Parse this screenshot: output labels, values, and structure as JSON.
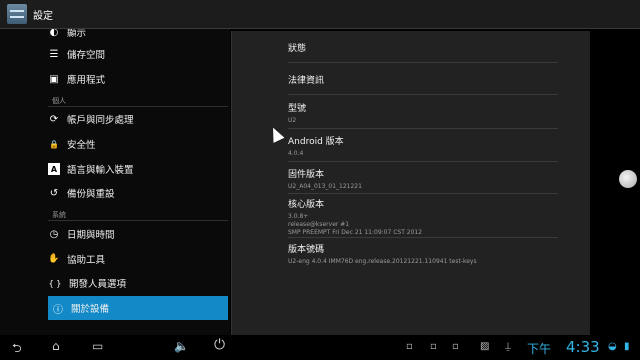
{
  "app": {
    "title": "設定"
  },
  "sidebar": {
    "items": [
      {
        "id": "display",
        "label": "顯示",
        "icon": "display-icon",
        "glyph": "◐"
      },
      {
        "id": "storage",
        "label": "儲存空間",
        "icon": "storage-icon",
        "glyph": "☰"
      },
      {
        "id": "apps",
        "label": "應用程式",
        "icon": "apps-icon",
        "glyph": "▣"
      },
      {
        "id": "accounts",
        "label": "帳戶與同步處理",
        "icon": "sync-icon",
        "glyph": "⟳"
      },
      {
        "id": "security",
        "label": "安全性",
        "icon": "lock-icon",
        "glyph": "🔒"
      },
      {
        "id": "language",
        "label": "語言與輸入裝置",
        "icon": "language-icon",
        "glyph": "A"
      },
      {
        "id": "backup",
        "label": "備份與重設",
        "icon": "backup-icon",
        "glyph": "↺"
      },
      {
        "id": "datetime",
        "label": "日期與時間",
        "icon": "clock-icon",
        "glyph": "◷"
      },
      {
        "id": "accessibility",
        "label": "協助工具",
        "icon": "hand-icon",
        "glyph": "✋"
      },
      {
        "id": "developer",
        "label": "開發人員選項",
        "icon": "developer-icon",
        "glyph": "{ }"
      },
      {
        "id": "about",
        "label": "關於設備",
        "icon": "info-icon",
        "glyph": "ⓘ"
      }
    ],
    "categories": {
      "personal": "個人",
      "system": "系統"
    }
  },
  "detail": {
    "rows": [
      {
        "title": "狀態",
        "sub": []
      },
      {
        "title": "法律資訊",
        "sub": []
      },
      {
        "title": "型號",
        "sub": [
          "U2"
        ]
      },
      {
        "title": "Android 版本",
        "sub": [
          "4.0.4"
        ]
      },
      {
        "title": "固件版本",
        "sub": [
          "U2_A04_013_01_121221"
        ]
      },
      {
        "title": "核心版本",
        "sub": [
          "3.0.8+",
          "release@kserver #1",
          "SMP PREEMPT Fri Dec 21 11:09:07 CST 2012"
        ]
      },
      {
        "title": "版本號碼",
        "sub": [
          "U2-eng 4.0.4 IMM76D eng.release.20121221.110941 test-keys"
        ]
      }
    ]
  },
  "navbar": {
    "back": "⮌",
    "home": "⌂",
    "recents": "▭",
    "screenshot": "⛶",
    "vol_down": "🔈",
    "vol_up": "🔊",
    "power": "⏻",
    "ampm": "下午",
    "time": "4:33"
  },
  "status_icons": [
    "notification-icon",
    "notification-icon",
    "notification-icon",
    "notification-icon",
    "gallery-icon",
    "usb-icon",
    "wifi-icon",
    "battery-icon"
  ]
}
